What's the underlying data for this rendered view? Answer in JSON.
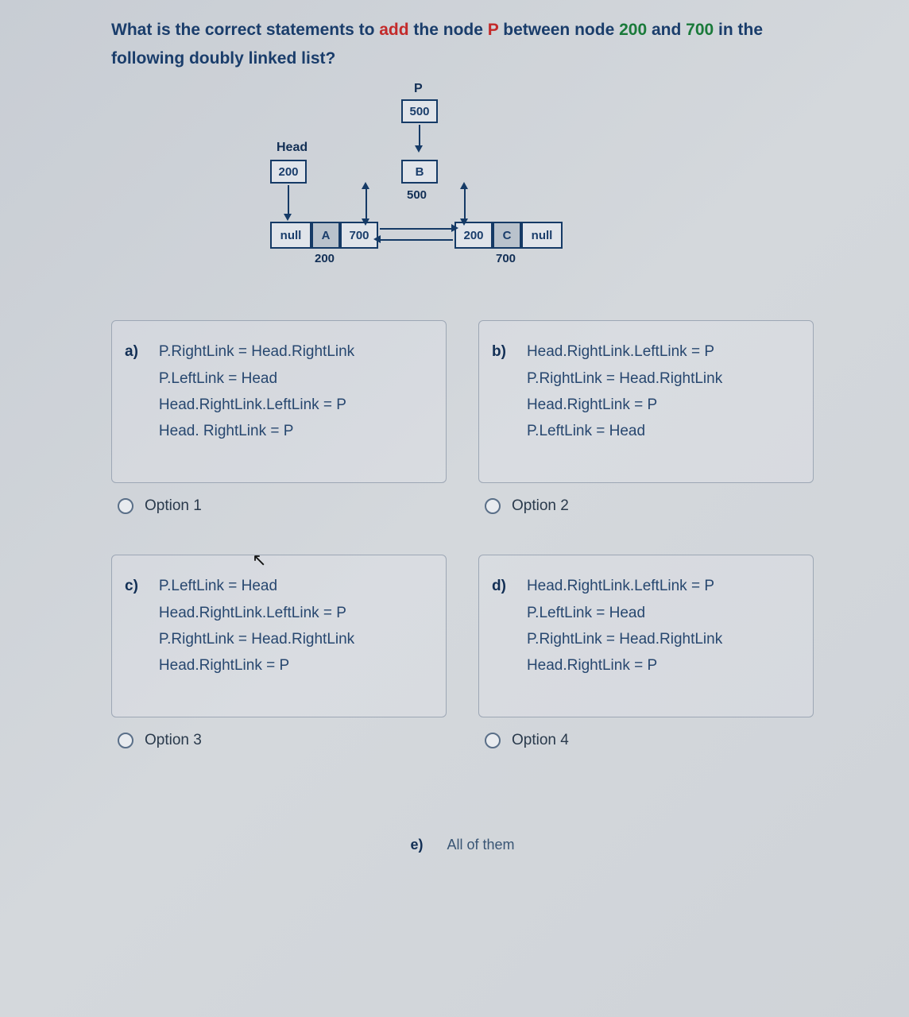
{
  "question": {
    "prefix": "What is the correct statements to ",
    "add": "add",
    "mid1": " the node ",
    "P": "P",
    "mid2": " between node ",
    "n200": "200",
    "and": " and ",
    "n700": "700",
    "suffix": " in the following doubly linked list?"
  },
  "diagram": {
    "P": "P",
    "p_val": "500",
    "Head": "Head",
    "head_val": "200",
    "B": "B",
    "b_val": "500",
    "A_left": "null",
    "A_mid": "A",
    "A_right": "700",
    "A_below": "200",
    "C_left": "200",
    "C_mid": "C",
    "C_right": "null",
    "C_below": "700"
  },
  "options": {
    "a": {
      "letter": "a)",
      "lines": [
        "P.RightLink = Head.RightLink",
        "P.LeftLink = Head",
        "Head.RightLink.LeftLink = P",
        "Head. RightLink = P"
      ],
      "label": "Option 1"
    },
    "b": {
      "letter": "b)",
      "lines": [
        "Head.RightLink.LeftLink = P",
        "P.RightLink = Head.RightLink",
        "Head.RightLink = P",
        "P.LeftLink = Head"
      ],
      "label": "Option 2"
    },
    "c": {
      "letter": "c)",
      "lines": [
        "P.LeftLink = Head",
        "Head.RightLink.LeftLink = P",
        "P.RightLink = Head.RightLink",
        "Head.RightLink = P"
      ],
      "label": "Option 3"
    },
    "d": {
      "letter": "d)",
      "lines": [
        "Head.RightLink.LeftLink = P",
        "P.LeftLink = Head",
        "P.RightLink = Head.RightLink",
        "Head.RightLink = P"
      ],
      "label": "Option 4"
    },
    "e": {
      "letter": "e)",
      "text": "All of them"
    }
  }
}
